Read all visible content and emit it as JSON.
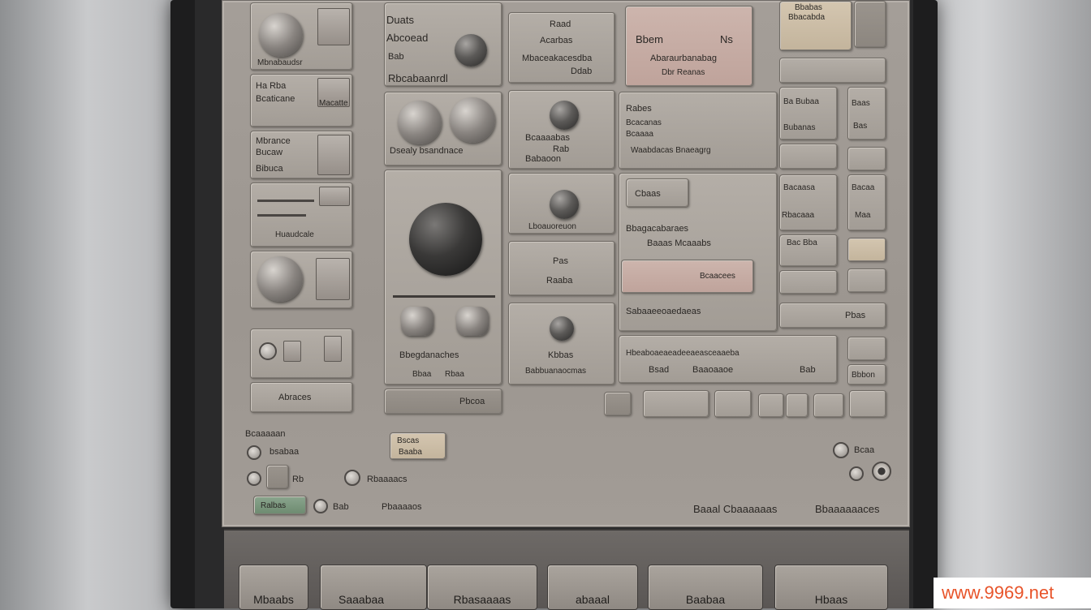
{
  "left_column": {
    "tile1_label": "Mbnabaudsr",
    "tile2_label": "Ha Rba",
    "tile2_sub": "Bcaticane",
    "tile2_right": "Macatte",
    "tile3_label": "Mbrance",
    "tile3_sub1": "Bucaw",
    "tile3_sub2": "Bibuca",
    "tile4_label": "Huaudcale",
    "tile6_label": "Abraces"
  },
  "col2": {
    "header_line1": "Duats",
    "header_line2": "Abcoead",
    "header_line3": "Bab",
    "header_line4": "Rbcabaanrdl",
    "tile2_label": "Dsealy bsandnace",
    "knob_tile_label": "Bbegdanaches",
    "knob_tile_sub1": "Bbaa",
    "knob_tile_sub2": "Rbaa",
    "bar_label": "Pbcoa"
  },
  "col3": {
    "tile1_label1": "Raad",
    "tile1_label2": "Acarbas",
    "tile1_label3": "Mbaceakacesdba",
    "tile1_label4": "Ddab",
    "tile2_label1": "Bcaaaabas",
    "tile2_label2": "Rab",
    "tile2_label3": "Babaoon",
    "tile3_label": "Lboauoreuon",
    "tile4_label1": "Pas",
    "tile4_label2": "Raaba",
    "tile5_label1": "Kbbas",
    "tile5_label2": "Babbuanaocmas"
  },
  "col4": {
    "pink_line1": "Bbem",
    "pink_line2": "Ns",
    "pink_line3": "Abaraurbanabag",
    "pink_line4": "Dbr Reanas",
    "tile2_label1": "Rabes",
    "tile2_label2": "Bcacanas",
    "tile2_label3": "Bcaaaa",
    "tile2_label4": "Waabdacas Bnaeagrg",
    "tag_label": "Cbaas",
    "head1": "Bbagacabaraes",
    "head2": "Baaas Mcaaabs",
    "pink2_label": "Bcaacees",
    "tile4_label": "Sabaaeeoaedaeas",
    "tile5_label": "Hbeaboaeaeadeeaeasceaaeba",
    "tile5_sub1": "Bsad",
    "tile5_sub2": "Baaoaaoe",
    "tile5_sub3": "Bab"
  },
  "right_column": {
    "cream_line1": "Bbabas",
    "cream_line2": "Bbacabda",
    "r1": "Ba Bubaa",
    "r2": "Bubanas",
    "r3": "Bacaasa",
    "r4": "Rbacaaa",
    "r5": "Bac Bba",
    "narrow1": "Baas",
    "narrow2": "Bas",
    "narrow3": "Bacaa",
    "narrow4": "Maa",
    "narrow5": "Bbbon",
    "wide_bar": "Pbas"
  },
  "bottom_area": {
    "left_caption": "Bcaaaaan",
    "radio1": "bsabaa",
    "radio2_mid": "Rb",
    "radio2_right": "Rbaaaacs",
    "green_badge": "Ralbas",
    "footer_left1": "Bab",
    "footer_left2": "Pbaaaaos",
    "center_tag_line1": "Bscas",
    "center_tag_line2": "Baaba",
    "right_radio": "Bcaa",
    "footer_right1": "Baaal Cbaaaaaas",
    "footer_right2": "Bbaaaaaaces"
  },
  "keys": [
    {
      "label": "Mbaabs"
    },
    {
      "label": "Saaabaa"
    },
    {
      "label": "Rbasaaaas"
    },
    {
      "label": "abaaal"
    },
    {
      "label": "Baabaa"
    },
    {
      "label": "Hbaas"
    }
  ],
  "watermark": "www.9969.net"
}
